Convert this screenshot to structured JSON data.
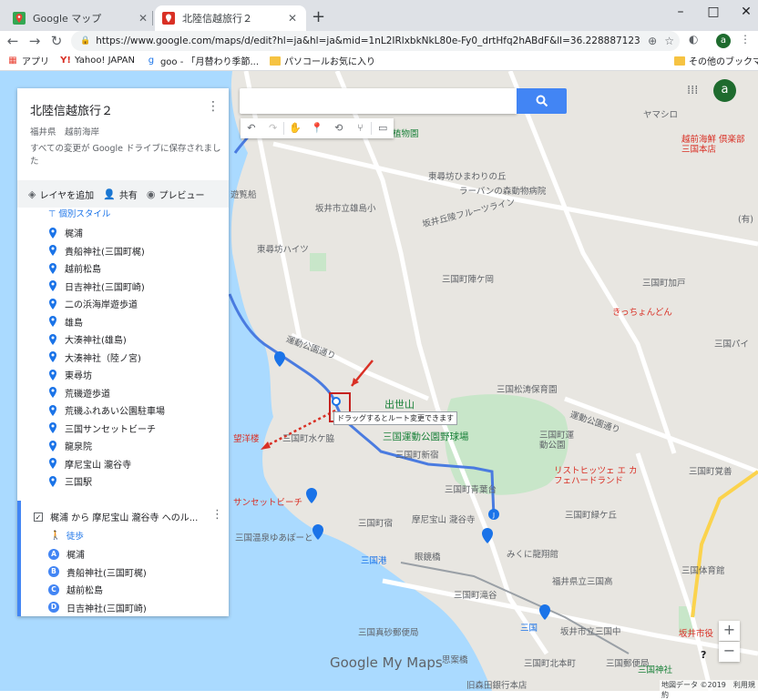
{
  "browser": {
    "tabs": [
      {
        "title": "Google マップ",
        "active": false
      },
      {
        "title": "北陸信越旅行２",
        "active": true
      }
    ],
    "url": "https://www.google.com/maps/d/edit?hl=ja&hl=ja&mid=1nL2IRlxbkNkL80e-Fy0_drtHfq2hABdF&ll=36.22888712325705%2C136.13952446...",
    "profile_initial": "a",
    "bookmarks": [
      "アプリ",
      "Yahoo! JAPAN",
      "goo - 「月替わり季節...",
      "パソコールお気に入り"
    ],
    "other_bookmarks": "その他のブックマーク",
    "window_controls": [
      "–",
      "□",
      "✕"
    ]
  },
  "panel": {
    "title": "北陸信越旅行２",
    "subtitle": "福井県　越前海岸",
    "saved_status": "すべての変更が Google ドライブに保存されました",
    "actions": {
      "add_layer": "レイヤを追加",
      "share": "共有",
      "preview": "プレビュー"
    },
    "style_label": "個別スタイル",
    "places": [
      "梶浦",
      "貴船神社(三国町梶)",
      "越前松島",
      "日吉神社(三国町崎)",
      "二の浜海岸遊歩道",
      "雄島",
      "大湊神社(雄島)",
      "大湊神社（陸ノ宮)",
      "東尋坊",
      "荒磯遊歩道",
      "荒磯ふれあい公園駐車場",
      "三国サンセットビーチ",
      "龍泉院",
      "摩尼宝山 瀧谷寺",
      "三国駅"
    ],
    "route": {
      "title": "梶浦 から 摩尼宝山 瀧谷寺 へのル...",
      "mode": "徒歩",
      "stops": [
        {
          "letter": "A",
          "name": "梶浦"
        },
        {
          "letter": "B",
          "name": "貴船神社(三国町梶)"
        },
        {
          "letter": "C",
          "name": "越前松島"
        },
        {
          "letter": "D",
          "name": "日吉神社(三国町崎)"
        }
      ]
    }
  },
  "map": {
    "tooltip": "ドラッグするとルート変更できます",
    "logo": "Google My Maps",
    "footer": "地図データ ©2019　利用規約",
    "help": "?",
    "zoom_in": "+",
    "zoom_out": "−",
    "labels": {
      "l1": "清水植物園",
      "l2": "東尋坊ひまわりの丘",
      "l3": "ラーバンの森動物病院",
      "l4": "坂井市立雄島小",
      "l5": "坂井丘陵フルーツライン",
      "l6": "東尋坊ハイツ",
      "l7": "三国町陣ケ岡",
      "l8": "三国町加戸",
      "l9": "きっちょんどん",
      "l10": "三国パイ",
      "l11": "運動公園通り",
      "l12": "三国松涛保育園",
      "l13": "出世山",
      "l14": "三国運動公園野球場",
      "l15": "三国町水ケ脇",
      "l16": "三国町新宿",
      "l17": "三国町運動公園",
      "l18": "リストヒッツェ エ カフェハードランド",
      "l19": "サンセットビーチ",
      "l20": "三国町青葉台",
      "l21": "三国町宿",
      "l22": "摩尼宝山 瀧谷寺",
      "l23": "三国町緑ケ丘",
      "l24": "三国温泉ゆあぽーと",
      "l25": "三国港",
      "l26": "眼鏡橋",
      "l27": "みくに龍翔館",
      "l28": "福井県立三国高",
      "l29": "三国体育館",
      "l30": "三国町滝谷",
      "l31": "三国",
      "l32": "坂井市立三国中",
      "l33": "三国真砂郵便局",
      "l34": "思案橋",
      "l35": "三国町北本町",
      "l36": "三国郵便局",
      "l37": "三国神社",
      "l38": "旧森田銀行本店",
      "l39": "坂井市役",
      "l40": "越前海鮮 倶楽部 三国本店",
      "l41": "ヤマシロ",
      "l42": "望洋楼",
      "l43": "遊覧船",
      "l44": "三国町覚善",
      "l45": "(有)"
    }
  },
  "colors": {
    "accent": "#4285f4",
    "route": "#4a7be0",
    "sea": "#aadaff",
    "annotation": "#c5221f"
  }
}
